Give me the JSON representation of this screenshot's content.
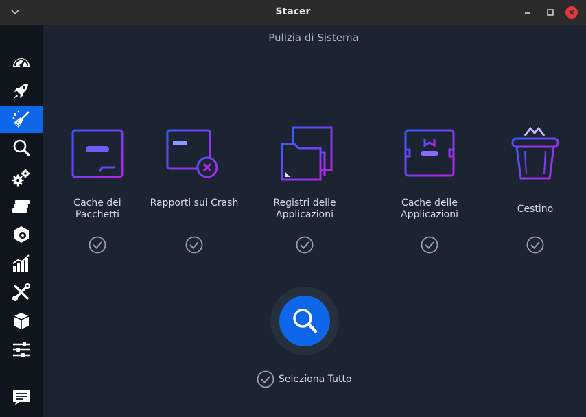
{
  "window": {
    "title": "Stacer"
  },
  "header": {
    "title": "Pulizia di Sistema"
  },
  "sidebar": {
    "items": [
      {
        "name": "dashboard",
        "icon": "speedometer-icon",
        "active": false
      },
      {
        "name": "startup-apps",
        "icon": "rocket-icon",
        "active": false
      },
      {
        "name": "system-cleaner",
        "icon": "broom-icon",
        "active": true
      },
      {
        "name": "search",
        "icon": "magnifier-icon",
        "active": false
      },
      {
        "name": "services",
        "icon": "gears-icon",
        "active": false
      },
      {
        "name": "processes",
        "icon": "cards-icon",
        "active": false
      },
      {
        "name": "uninstaller",
        "icon": "package-icon",
        "active": false
      },
      {
        "name": "resources",
        "icon": "chart-icon",
        "active": false
      },
      {
        "name": "helpers",
        "icon": "tools-icon",
        "active": false
      },
      {
        "name": "apt-repository",
        "icon": "box-icon",
        "active": false
      },
      {
        "name": "settings",
        "icon": "sliders-icon",
        "active": false
      },
      {
        "name": "feedback",
        "icon": "chat-icon",
        "active": false
      }
    ]
  },
  "categories": [
    {
      "label": "Cache dei Pacchetti",
      "checked": true,
      "icon": "package-cache-icon"
    },
    {
      "label": "Rapporti sui Crash",
      "checked": true,
      "icon": "crash-report-icon"
    },
    {
      "label": "Registri delle Applicazioni",
      "checked": true,
      "icon": "folder-logs-icon"
    },
    {
      "label": "Cache delle Applicazioni",
      "checked": true,
      "icon": "app-cache-icon"
    },
    {
      "label": "Cestino",
      "checked": true,
      "icon": "trash-basket-icon"
    }
  ],
  "select_all": {
    "label": "Seleziona Tutto",
    "checked": true
  },
  "colors": {
    "accent": "#0e66e8",
    "sidebar_bg": "#0f151c",
    "content_bg": "#1b2430",
    "titlebar_bg": "#2b2b2b",
    "close": "#e0383e",
    "icon_gradient_start": "#3b5bff",
    "icon_gradient_end": "#b226e8"
  }
}
